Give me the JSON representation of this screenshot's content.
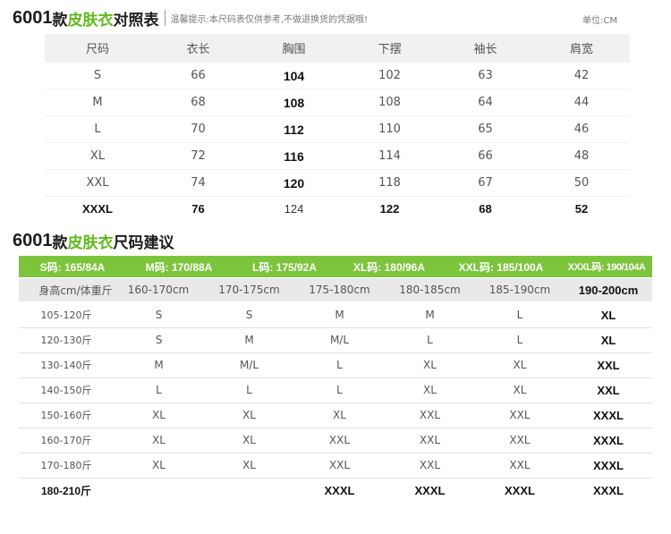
{
  "chart1": {
    "title_num": "6001",
    "title_kuan": "款",
    "title_green": "皮肤衣",
    "title_rest": "对照表",
    "note": "温馨提示:本尺码表仅供参考,不做退换货的凭据哦!",
    "unit": "单位:CM",
    "headers": [
      "尺码",
      "衣长",
      "胸围",
      "下摆",
      "袖长",
      "肩宽"
    ],
    "rows": [
      [
        "S",
        "66",
        "104",
        "102",
        "63",
        "42"
      ],
      [
        "M",
        "68",
        "108",
        "108",
        "64",
        "44"
      ],
      [
        "L",
        "70",
        "112",
        "110",
        "65",
        "46"
      ],
      [
        "XL",
        "72",
        "116",
        "114",
        "66",
        "48"
      ],
      [
        "XXL",
        "74",
        "120",
        "118",
        "67",
        "50"
      ],
      [
        "XXXL",
        "76",
        "124",
        "122",
        "68",
        "52"
      ]
    ]
  },
  "chart2": {
    "title_num": "6001",
    "title_kuan": "款",
    "title_green": "皮肤衣",
    "title_rest": "尺码建议",
    "size_bar": [
      "S码: 165/84A",
      "M码: 170/88A",
      "L码: 175/92A",
      "XL码: 180/96A",
      "XXL码: 185/100A",
      "XXXL码: 190/104A"
    ],
    "header": [
      "身高cm/体重斤",
      "160-170cm",
      "170-175cm",
      "175-180cm",
      "180-185cm",
      "185-190cm",
      "190-200cm"
    ],
    "rows": [
      [
        "105-120斤",
        "S",
        "S",
        "M",
        "M",
        "L",
        "XL"
      ],
      [
        "120-130斤",
        "S",
        "M",
        "M/L",
        "L",
        "L",
        "XL"
      ],
      [
        "130-140斤",
        "M",
        "M/L",
        "L",
        "XL",
        "XL",
        "XXL"
      ],
      [
        "140-150斤",
        "L",
        "L",
        "L",
        "XL",
        "XL",
        "XXL"
      ],
      [
        "150-160斤",
        "XL",
        "XL",
        "XL",
        "XXL",
        "XXL",
        "XXXL"
      ],
      [
        "160-170斤",
        "XL",
        "XL",
        "XXL",
        "XXL",
        "XXL",
        "XXXL"
      ],
      [
        "170-180斤",
        "XL",
        "XL",
        "XXL",
        "XXL",
        "XXL",
        "XXXL"
      ],
      [
        "180-210斤",
        "",
        "",
        "XXXL",
        "XXXL",
        "XXXL",
        "XXXL"
      ]
    ]
  },
  "colors": {
    "green_bar": "#7dc43d",
    "green_text": "#61b820",
    "header_bg": "#e9e9e9"
  }
}
